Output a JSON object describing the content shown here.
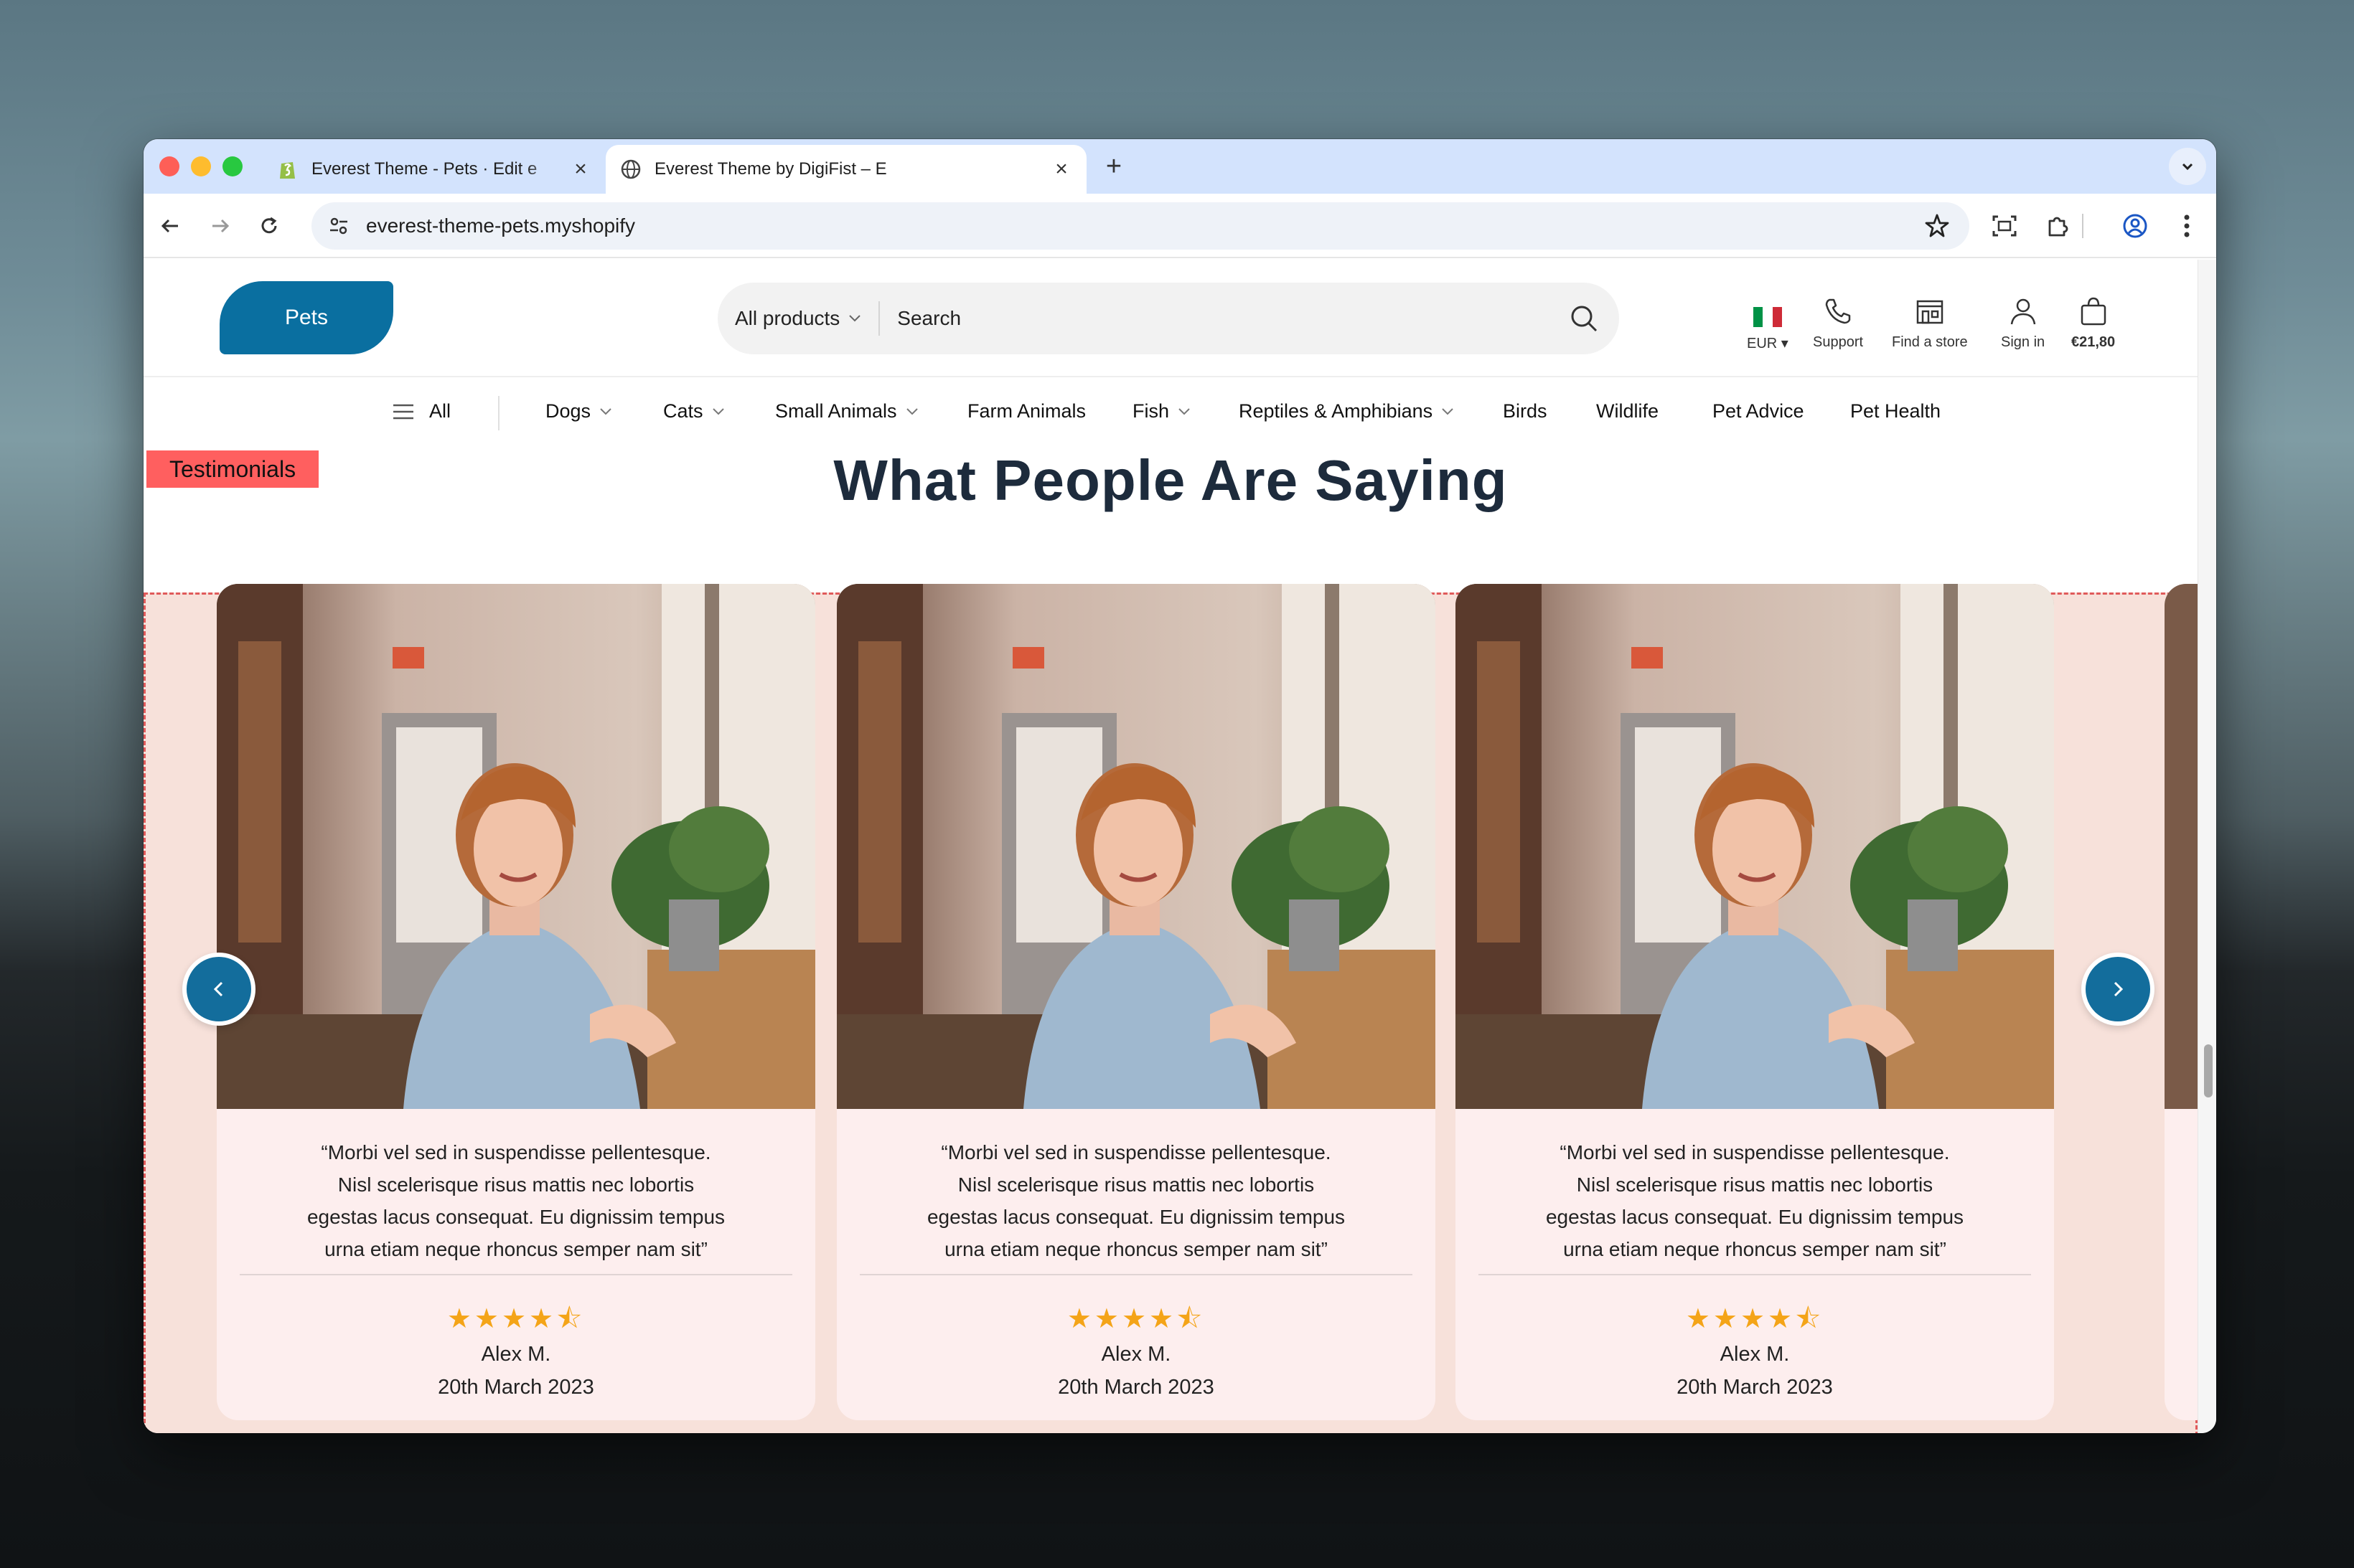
{
  "browser": {
    "tabs": [
      {
        "title": "Everest Theme - Pets · Edit e",
        "active": false
      },
      {
        "title": "Everest Theme by DigiFist – E",
        "active": true
      }
    ],
    "url": "everest-theme-pets.myshopify"
  },
  "header": {
    "logo": "Pets",
    "search": {
      "category": "All products",
      "placeholder": "Search"
    },
    "currency": "EUR",
    "support": "Support",
    "find_store": "Find a store",
    "sign_in": "Sign in",
    "cart": "€21,80"
  },
  "nav": {
    "all": "All",
    "items": [
      {
        "label": "Dogs",
        "dropdown": true
      },
      {
        "label": "Cats",
        "dropdown": true
      },
      {
        "label": "Small Animals",
        "dropdown": true
      },
      {
        "label": "Farm Animals",
        "dropdown": false
      },
      {
        "label": "Fish",
        "dropdown": true
      },
      {
        "label": "Reptiles & Amphibians",
        "dropdown": true
      },
      {
        "label": "Birds",
        "dropdown": false
      },
      {
        "label": "Wildlife",
        "dropdown": false
      },
      {
        "label": "Pet Advice",
        "dropdown": false
      },
      {
        "label": "Pet Health",
        "dropdown": false
      }
    ]
  },
  "testimonials": {
    "tag": "Testimonials",
    "title": "What People Are Saying",
    "rating": 4.5,
    "cards": [
      {
        "quote_lines": [
          "“Morbi vel sed in suspendisse pellentesque.",
          "Nisl scelerisque risus mattis nec lobortis",
          "egestas lacus consequat. Eu dignissim tempus",
          "urna etiam neque rhoncus semper nam sit”"
        ],
        "stars": "★★★★⯪",
        "name": "Alex M.",
        "date": "20th March 2023"
      },
      {
        "quote_lines": [
          "“Morbi vel sed in suspendisse pellentesque.",
          "Nisl scelerisque risus mattis nec lobortis",
          "egestas lacus consequat. Eu dignissim tempus",
          "urna etiam neque rhoncus semper nam sit”"
        ],
        "stars": "★★★★⯪",
        "name": "Alex M.",
        "date": "20th March 2023"
      },
      {
        "quote_lines": [
          "“Morbi vel sed in suspendisse pellentesque.",
          "Nisl scelerisque risus mattis nec lobortis",
          "egestas lacus consequat. Eu dignissim tempus",
          "urna etiam neque rhoncus semper nam sit”"
        ],
        "stars": "★★★★⯪",
        "name": "Alex M.",
        "date": "20th March 2023"
      }
    ]
  },
  "colors": {
    "brand": "#0a6fa0",
    "star": "#f4a418",
    "section_bg": "#f7e1da",
    "tag_bg": "#ff5f5f"
  }
}
